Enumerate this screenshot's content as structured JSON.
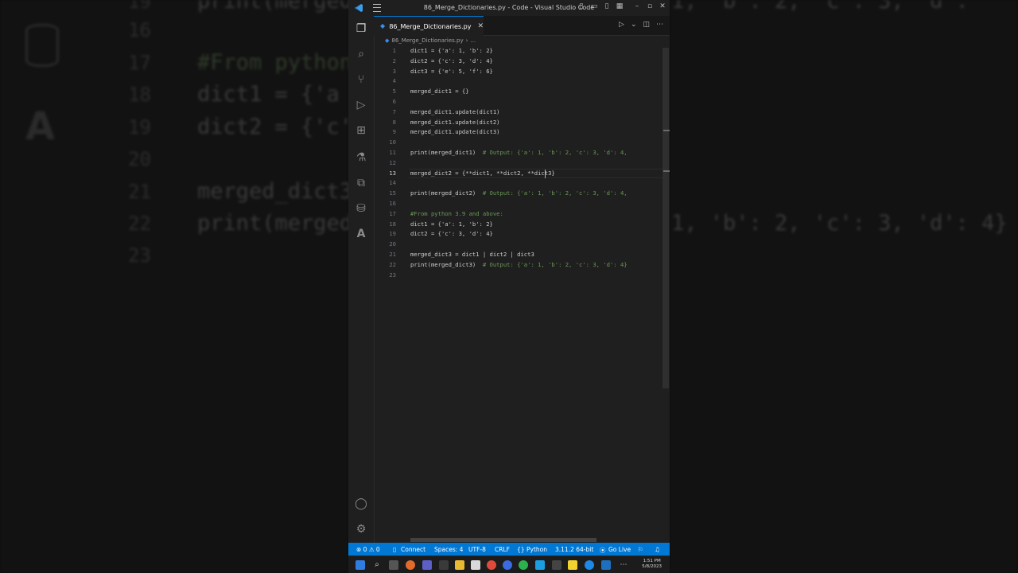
{
  "window": {
    "title": "86_Merge_Dictionaries.py - Code - Visual Studio Code"
  },
  "tab": {
    "label": "86_Merge_Dictionaries.py",
    "close": "✕"
  },
  "breadcrumb": {
    "file": "86_Merge_Dictionaries.py",
    "separator": "›",
    "more": "..."
  },
  "activitybar": {
    "icons": [
      "explorer-icon",
      "search-icon",
      "source-control-icon",
      "run-debug-icon",
      "extensions-icon",
      "testing-icon",
      "remote-explorer-icon",
      "database-icon",
      "azure-icon",
      "account-icon",
      "settings-gear-icon"
    ]
  },
  "code": {
    "active_line": 13,
    "lines": [
      {
        "n": "1",
        "text": "dict1 = {'a': 1, 'b': 2}"
      },
      {
        "n": "2",
        "text": "dict2 = {'c': 3, 'd': 4}"
      },
      {
        "n": "3",
        "text": "dict3 = {'e': 5, 'f': 6}"
      },
      {
        "n": "4",
        "text": ""
      },
      {
        "n": "5",
        "text": "merged_dict1 = {}"
      },
      {
        "n": "6",
        "text": ""
      },
      {
        "n": "7",
        "text": "merged_dict1.update(dict1)"
      },
      {
        "n": "8",
        "text": "merged_dict1.update(dict2)"
      },
      {
        "n": "9",
        "text": "merged_dict1.update(dict3)"
      },
      {
        "n": "10",
        "text": ""
      },
      {
        "n": "11",
        "text": "print(merged_dict1)",
        "comment": "# Output: {'a': 1, 'b': 2, 'c': 3, 'd': 4,"
      },
      {
        "n": "12",
        "text": ""
      },
      {
        "n": "13",
        "text": "merged_dict2 = {**dict1, **dict2, **dict3}"
      },
      {
        "n": "14",
        "text": ""
      },
      {
        "n": "15",
        "text": "print(merged_dict2)",
        "comment": "# Output: {'a': 1, 'b': 2, 'c': 3, 'd': 4,"
      },
      {
        "n": "16",
        "text": ""
      },
      {
        "n": "17",
        "text": "",
        "comment": "#From python 3.9 and above:"
      },
      {
        "n": "18",
        "text": "dict1 = {'a': 1, 'b': 2}"
      },
      {
        "n": "19",
        "text": "dict2 = {'c': 3, 'd': 4}"
      },
      {
        "n": "20",
        "text": ""
      },
      {
        "n": "21",
        "text": "merged_dict3 = dict1 | dict2 | dict3"
      },
      {
        "n": "22",
        "text": "print(merged_dict3)",
        "comment": "# Output: {'a': 1, 'b': 2, 'c': 3, 'd': 4}"
      },
      {
        "n": "23",
        "text": ""
      }
    ]
  },
  "statusbar": {
    "problems": "⊗ 0 ⚠ 0",
    "connect": "Connect",
    "spaces": "Spaces: 4",
    "encoding": "UTF-8",
    "eol": "CRLF",
    "language": "Python",
    "interpreter": "3.11.2 64-bit",
    "golive": "Go Live"
  },
  "taskbar": {
    "time": "1:51 PM",
    "date": "5/8/2023"
  },
  "background": {
    "numbers": [
      "19",
      "16",
      "17",
      "18",
      "19",
      "20",
      "21",
      "22",
      "23"
    ],
    "lines": [
      "print(merged",
      "#From python",
      "dict1 = {'a",
      "dict2 = {'c'",
      "merged_dict3",
      "print(merged"
    ],
    "right_lines": [
      "1, 'b': 2, 'c': 3, 'd':",
      "1, 'b': 2, 'c': 3, 'd': 4}"
    ]
  },
  "colors": {
    "accent": "#0078d4",
    "editor_bg": "#1f1f1f",
    "comment": "#6a9955"
  }
}
